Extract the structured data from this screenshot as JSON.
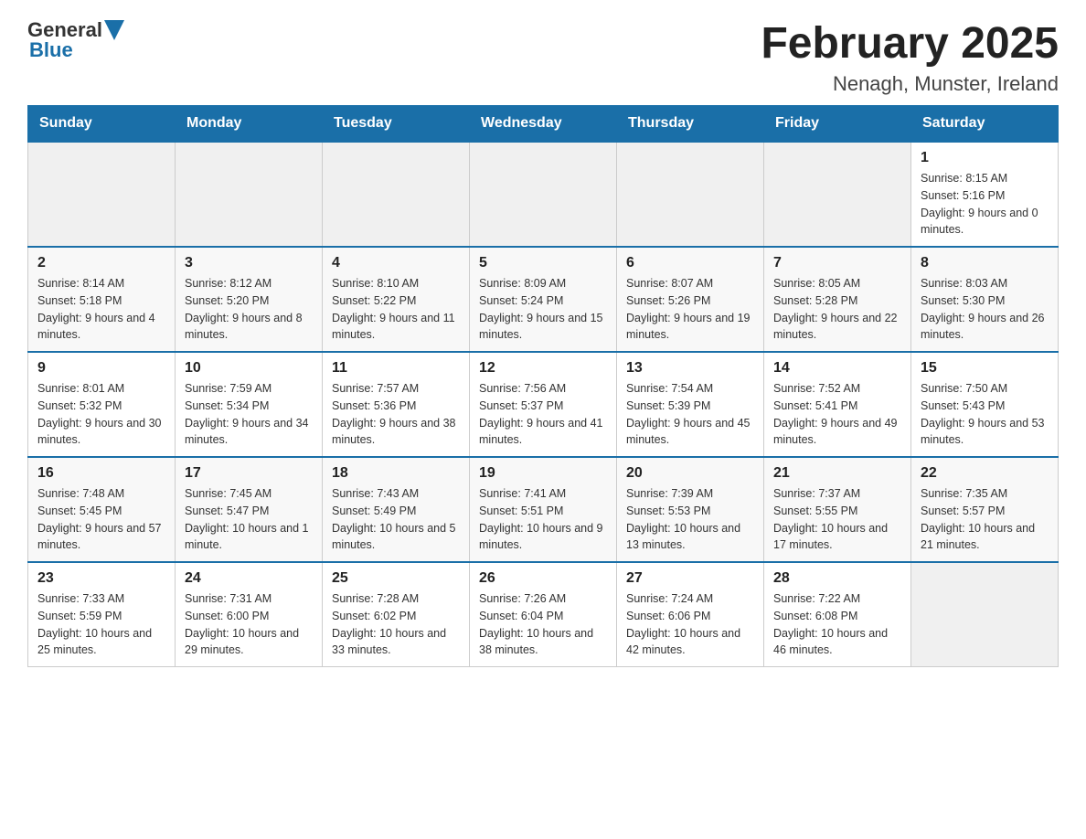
{
  "header": {
    "logo_general": "General",
    "logo_blue": "Blue",
    "month_title": "February 2025",
    "location": "Nenagh, Munster, Ireland"
  },
  "days_of_week": [
    "Sunday",
    "Monday",
    "Tuesday",
    "Wednesday",
    "Thursday",
    "Friday",
    "Saturday"
  ],
  "weeks": [
    [
      {
        "day": "",
        "info": ""
      },
      {
        "day": "",
        "info": ""
      },
      {
        "day": "",
        "info": ""
      },
      {
        "day": "",
        "info": ""
      },
      {
        "day": "",
        "info": ""
      },
      {
        "day": "",
        "info": ""
      },
      {
        "day": "1",
        "info": "Sunrise: 8:15 AM\nSunset: 5:16 PM\nDaylight: 9 hours and 0 minutes."
      }
    ],
    [
      {
        "day": "2",
        "info": "Sunrise: 8:14 AM\nSunset: 5:18 PM\nDaylight: 9 hours and 4 minutes."
      },
      {
        "day": "3",
        "info": "Sunrise: 8:12 AM\nSunset: 5:20 PM\nDaylight: 9 hours and 8 minutes."
      },
      {
        "day": "4",
        "info": "Sunrise: 8:10 AM\nSunset: 5:22 PM\nDaylight: 9 hours and 11 minutes."
      },
      {
        "day": "5",
        "info": "Sunrise: 8:09 AM\nSunset: 5:24 PM\nDaylight: 9 hours and 15 minutes."
      },
      {
        "day": "6",
        "info": "Sunrise: 8:07 AM\nSunset: 5:26 PM\nDaylight: 9 hours and 19 minutes."
      },
      {
        "day": "7",
        "info": "Sunrise: 8:05 AM\nSunset: 5:28 PM\nDaylight: 9 hours and 22 minutes."
      },
      {
        "day": "8",
        "info": "Sunrise: 8:03 AM\nSunset: 5:30 PM\nDaylight: 9 hours and 26 minutes."
      }
    ],
    [
      {
        "day": "9",
        "info": "Sunrise: 8:01 AM\nSunset: 5:32 PM\nDaylight: 9 hours and 30 minutes."
      },
      {
        "day": "10",
        "info": "Sunrise: 7:59 AM\nSunset: 5:34 PM\nDaylight: 9 hours and 34 minutes."
      },
      {
        "day": "11",
        "info": "Sunrise: 7:57 AM\nSunset: 5:36 PM\nDaylight: 9 hours and 38 minutes."
      },
      {
        "day": "12",
        "info": "Sunrise: 7:56 AM\nSunset: 5:37 PM\nDaylight: 9 hours and 41 minutes."
      },
      {
        "day": "13",
        "info": "Sunrise: 7:54 AM\nSunset: 5:39 PM\nDaylight: 9 hours and 45 minutes."
      },
      {
        "day": "14",
        "info": "Sunrise: 7:52 AM\nSunset: 5:41 PM\nDaylight: 9 hours and 49 minutes."
      },
      {
        "day": "15",
        "info": "Sunrise: 7:50 AM\nSunset: 5:43 PM\nDaylight: 9 hours and 53 minutes."
      }
    ],
    [
      {
        "day": "16",
        "info": "Sunrise: 7:48 AM\nSunset: 5:45 PM\nDaylight: 9 hours and 57 minutes."
      },
      {
        "day": "17",
        "info": "Sunrise: 7:45 AM\nSunset: 5:47 PM\nDaylight: 10 hours and 1 minute."
      },
      {
        "day": "18",
        "info": "Sunrise: 7:43 AM\nSunset: 5:49 PM\nDaylight: 10 hours and 5 minutes."
      },
      {
        "day": "19",
        "info": "Sunrise: 7:41 AM\nSunset: 5:51 PM\nDaylight: 10 hours and 9 minutes."
      },
      {
        "day": "20",
        "info": "Sunrise: 7:39 AM\nSunset: 5:53 PM\nDaylight: 10 hours and 13 minutes."
      },
      {
        "day": "21",
        "info": "Sunrise: 7:37 AM\nSunset: 5:55 PM\nDaylight: 10 hours and 17 minutes."
      },
      {
        "day": "22",
        "info": "Sunrise: 7:35 AM\nSunset: 5:57 PM\nDaylight: 10 hours and 21 minutes."
      }
    ],
    [
      {
        "day": "23",
        "info": "Sunrise: 7:33 AM\nSunset: 5:59 PM\nDaylight: 10 hours and 25 minutes."
      },
      {
        "day": "24",
        "info": "Sunrise: 7:31 AM\nSunset: 6:00 PM\nDaylight: 10 hours and 29 minutes."
      },
      {
        "day": "25",
        "info": "Sunrise: 7:28 AM\nSunset: 6:02 PM\nDaylight: 10 hours and 33 minutes."
      },
      {
        "day": "26",
        "info": "Sunrise: 7:26 AM\nSunset: 6:04 PM\nDaylight: 10 hours and 38 minutes."
      },
      {
        "day": "27",
        "info": "Sunrise: 7:24 AM\nSunset: 6:06 PM\nDaylight: 10 hours and 42 minutes."
      },
      {
        "day": "28",
        "info": "Sunrise: 7:22 AM\nSunset: 6:08 PM\nDaylight: 10 hours and 46 minutes."
      },
      {
        "day": "",
        "info": ""
      }
    ]
  ]
}
